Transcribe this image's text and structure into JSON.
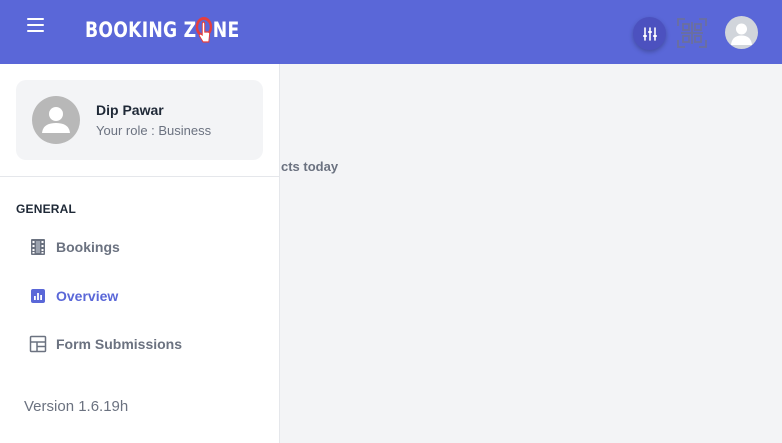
{
  "topbar": {
    "logo_part1": "BOOKING Z",
    "logo_part2": "NE",
    "filter_icon": "sliders-icon",
    "qr_icon": "qr-scan-icon",
    "avatar_icon": "user-avatar-icon",
    "accent_color": "#5a67d8"
  },
  "sidebar": {
    "profile": {
      "name": "Dip Pawar",
      "role": "Your role : Business"
    },
    "section_label": "GENERAL",
    "items": [
      {
        "label": "Bookings",
        "icon": "film-icon",
        "active": false
      },
      {
        "label": "Overview",
        "icon": "bar-chart-icon",
        "active": true
      },
      {
        "label": "Form Submissions",
        "icon": "layout-icon",
        "active": false
      }
    ],
    "version": "Version 1.6.19h"
  },
  "main": {
    "partial_text": "cts today"
  }
}
